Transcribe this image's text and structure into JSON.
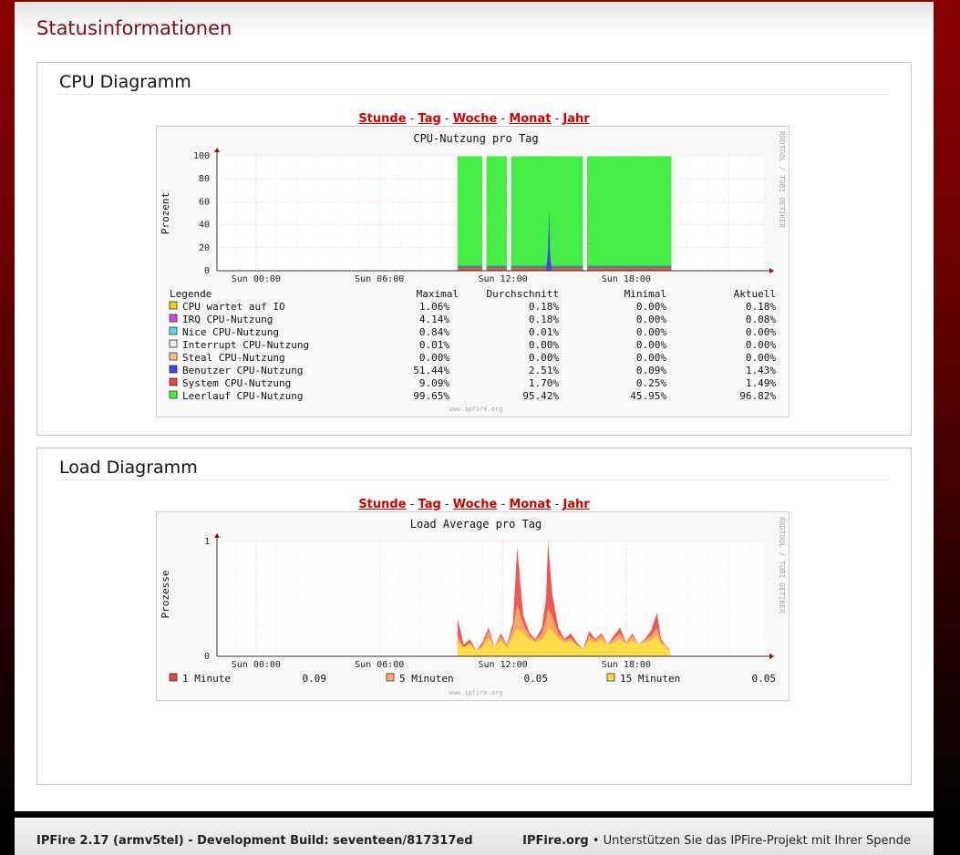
{
  "page": {
    "title": "Statusinformationen"
  },
  "range_links": {
    "hour": "Stunde",
    "day": "Tag",
    "week": "Woche",
    "month": "Monat",
    "year": "Jahr",
    "sep": " - "
  },
  "cpu": {
    "section_title": "CPU Diagramm",
    "chart_title": "CPU-Nutzung pro Tag",
    "ylabel": "Prozent",
    "watermark": "RRDTOOL / TOBI OETIKER",
    "credit": "www.ipfire.org",
    "legend_header": {
      "label": "Legende",
      "max": "Maximal",
      "avg": "Durchschnitt",
      "min": "Minimal",
      "cur": "Aktuell"
    },
    "legend": [
      {
        "label": "CPU wartet auf IO",
        "color": "#ffcc00",
        "max": "1.06%",
        "avg": "0.18%",
        "min": "0.00%",
        "cur": "0.18%"
      },
      {
        "label": "IRQ CPU-Nutzung",
        "color": "#dd44dd",
        "max": "4.14%",
        "avg": "0.18%",
        "min": "0.00%",
        "cur": "0.08%"
      },
      {
        "label": "Nice CPU-Nutzung",
        "color": "#55dddd",
        "max": "0.84%",
        "avg": "0.01%",
        "min": "0.00%",
        "cur": "0.00%"
      },
      {
        "label": "Interrupt CPU-Nutzung",
        "color": "#eeeeee",
        "max": "0.01%",
        "avg": "0.00%",
        "min": "0.00%",
        "cur": "0.00%"
      },
      {
        "label": "Steal CPU-Nutzung",
        "color": "#ffbb77",
        "max": "0.00%",
        "avg": "0.00%",
        "min": "0.00%",
        "cur": "0.00%"
      },
      {
        "label": "Benutzer CPU-Nutzung",
        "color": "#4444ee",
        "max": "51.44%",
        "avg": "2.51%",
        "min": "0.09%",
        "cur": "1.43%"
      },
      {
        "label": "System CPU-Nutzung",
        "color": "#ee4444",
        "max": "9.09%",
        "avg": "1.70%",
        "min": "0.25%",
        "cur": "1.49%"
      },
      {
        "label": "Leerlauf CPU-Nutzung",
        "color": "#44ee44",
        "max": "99.65%",
        "avg": "95.42%",
        "min": "45.95%",
        "cur": "96.82%"
      }
    ]
  },
  "load": {
    "section_title": "Load Diagramm",
    "chart_title": "Load Average pro Tag",
    "ylabel": "Prozesse",
    "watermark": "RRDTOOL / TOBI OETIKER",
    "credit": "www.ipfire.org",
    "legend": [
      {
        "label": "1 Minute",
        "color": "#ee4444",
        "value": "0.09"
      },
      {
        "label": "5 Minuten",
        "color": "#ffaa66",
        "value": "0.05"
      },
      {
        "label": "15 Minuten",
        "color": "#ffdd44",
        "value": "0.05"
      }
    ]
  },
  "chart_data": [
    {
      "type": "area",
      "title": "CPU-Nutzung pro Tag",
      "xlabel": "",
      "ylabel": "Prozent",
      "x_ticks": [
        "Sun 00:00",
        "Sun 06:00",
        "Sun 12:00",
        "Sun 18:00"
      ],
      "y_ticks": [
        "0",
        "20",
        "40",
        "60",
        "80",
        "100"
      ],
      "ylim": [
        0,
        100
      ],
      "grid": true,
      "data_segments_hours": [
        [
          9.8,
          11.0
        ],
        [
          11.2,
          12.2
        ],
        [
          12.4,
          15.9
        ],
        [
          16.1,
          20.2
        ]
      ],
      "series": [
        {
          "name": "Leerlauf CPU-Nutzung",
          "avg": 95.42,
          "max": 99.65,
          "min": 45.95,
          "current": 96.82
        },
        {
          "name": "Benutzer CPU-Nutzung",
          "avg": 2.51,
          "max": 51.44,
          "min": 0.09,
          "current": 1.43,
          "peak_time": "Sun 14:15"
        },
        {
          "name": "System CPU-Nutzung",
          "avg": 1.7,
          "max": 9.09,
          "min": 0.25,
          "current": 1.49
        },
        {
          "name": "IRQ CPU-Nutzung",
          "avg": 0.18,
          "max": 4.14,
          "min": 0.0,
          "current": 0.08
        },
        {
          "name": "CPU wartet auf IO",
          "avg": 0.18,
          "max": 1.06,
          "min": 0.0,
          "current": 0.18
        }
      ]
    },
    {
      "type": "area",
      "title": "Load Average pro Tag",
      "xlabel": "",
      "ylabel": "Prozesse",
      "x_ticks": [
        "Sun 00:00",
        "Sun 06:00",
        "Sun 12:00",
        "Sun 18:00"
      ],
      "y_ticks": [
        "0",
        "1"
      ],
      "ylim": [
        0,
        1
      ],
      "grid": true,
      "x_hours": [
        9.8,
        10.1,
        10.4,
        10.7,
        11.0,
        11.3,
        11.6,
        11.9,
        12.2,
        12.5,
        12.7,
        13.0,
        13.3,
        13.6,
        13.9,
        14.1,
        14.2,
        14.4,
        14.7,
        15.0,
        15.3,
        15.6,
        15.9,
        16.2,
        16.5,
        16.8,
        17.1,
        17.4,
        17.7,
        18.0,
        18.3,
        18.6,
        18.9,
        19.2,
        19.5,
        19.7,
        19.9,
        20.1
      ],
      "series": [
        {
          "name": "1 Minute",
          "current": 0.09,
          "values": [
            0.33,
            0.1,
            0.15,
            0.05,
            0.12,
            0.25,
            0.08,
            0.2,
            0.1,
            0.3,
            0.95,
            0.35,
            0.2,
            0.15,
            0.25,
            0.5,
            1.0,
            0.55,
            0.25,
            0.15,
            0.2,
            0.12,
            0.06,
            0.22,
            0.15,
            0.2,
            0.1,
            0.18,
            0.25,
            0.12,
            0.2,
            0.1,
            0.15,
            0.22,
            0.38,
            0.15,
            0.1,
            0.06
          ]
        },
        {
          "name": "5 Minuten",
          "current": 0.05,
          "values": [
            0.18,
            0.08,
            0.12,
            0.05,
            0.1,
            0.22,
            0.08,
            0.18,
            0.09,
            0.25,
            0.45,
            0.28,
            0.18,
            0.14,
            0.2,
            0.32,
            0.42,
            0.35,
            0.2,
            0.14,
            0.16,
            0.1,
            0.06,
            0.18,
            0.14,
            0.18,
            0.1,
            0.15,
            0.2,
            0.12,
            0.18,
            0.1,
            0.14,
            0.18,
            0.25,
            0.13,
            0.1,
            0.05
          ]
        },
        {
          "name": "15 Minuten",
          "current": 0.05,
          "values": [
            0.12,
            0.08,
            0.1,
            0.05,
            0.08,
            0.15,
            0.08,
            0.14,
            0.08,
            0.18,
            0.25,
            0.2,
            0.15,
            0.12,
            0.15,
            0.2,
            0.25,
            0.22,
            0.16,
            0.12,
            0.13,
            0.1,
            0.06,
            0.14,
            0.12,
            0.14,
            0.1,
            0.12,
            0.15,
            0.11,
            0.14,
            0.1,
            0.12,
            0.14,
            0.18,
            0.11,
            0.09,
            0.05
          ]
        }
      ]
    }
  ],
  "footer": {
    "version": "IPFire 2.17 (armv5tel) - Development Build: seventeen/817317ed",
    "brand": "IPFire.org",
    "bullet": "•",
    "donate": "Unterstützen Sie das IPFire-Projekt mit Ihrer Spende"
  }
}
